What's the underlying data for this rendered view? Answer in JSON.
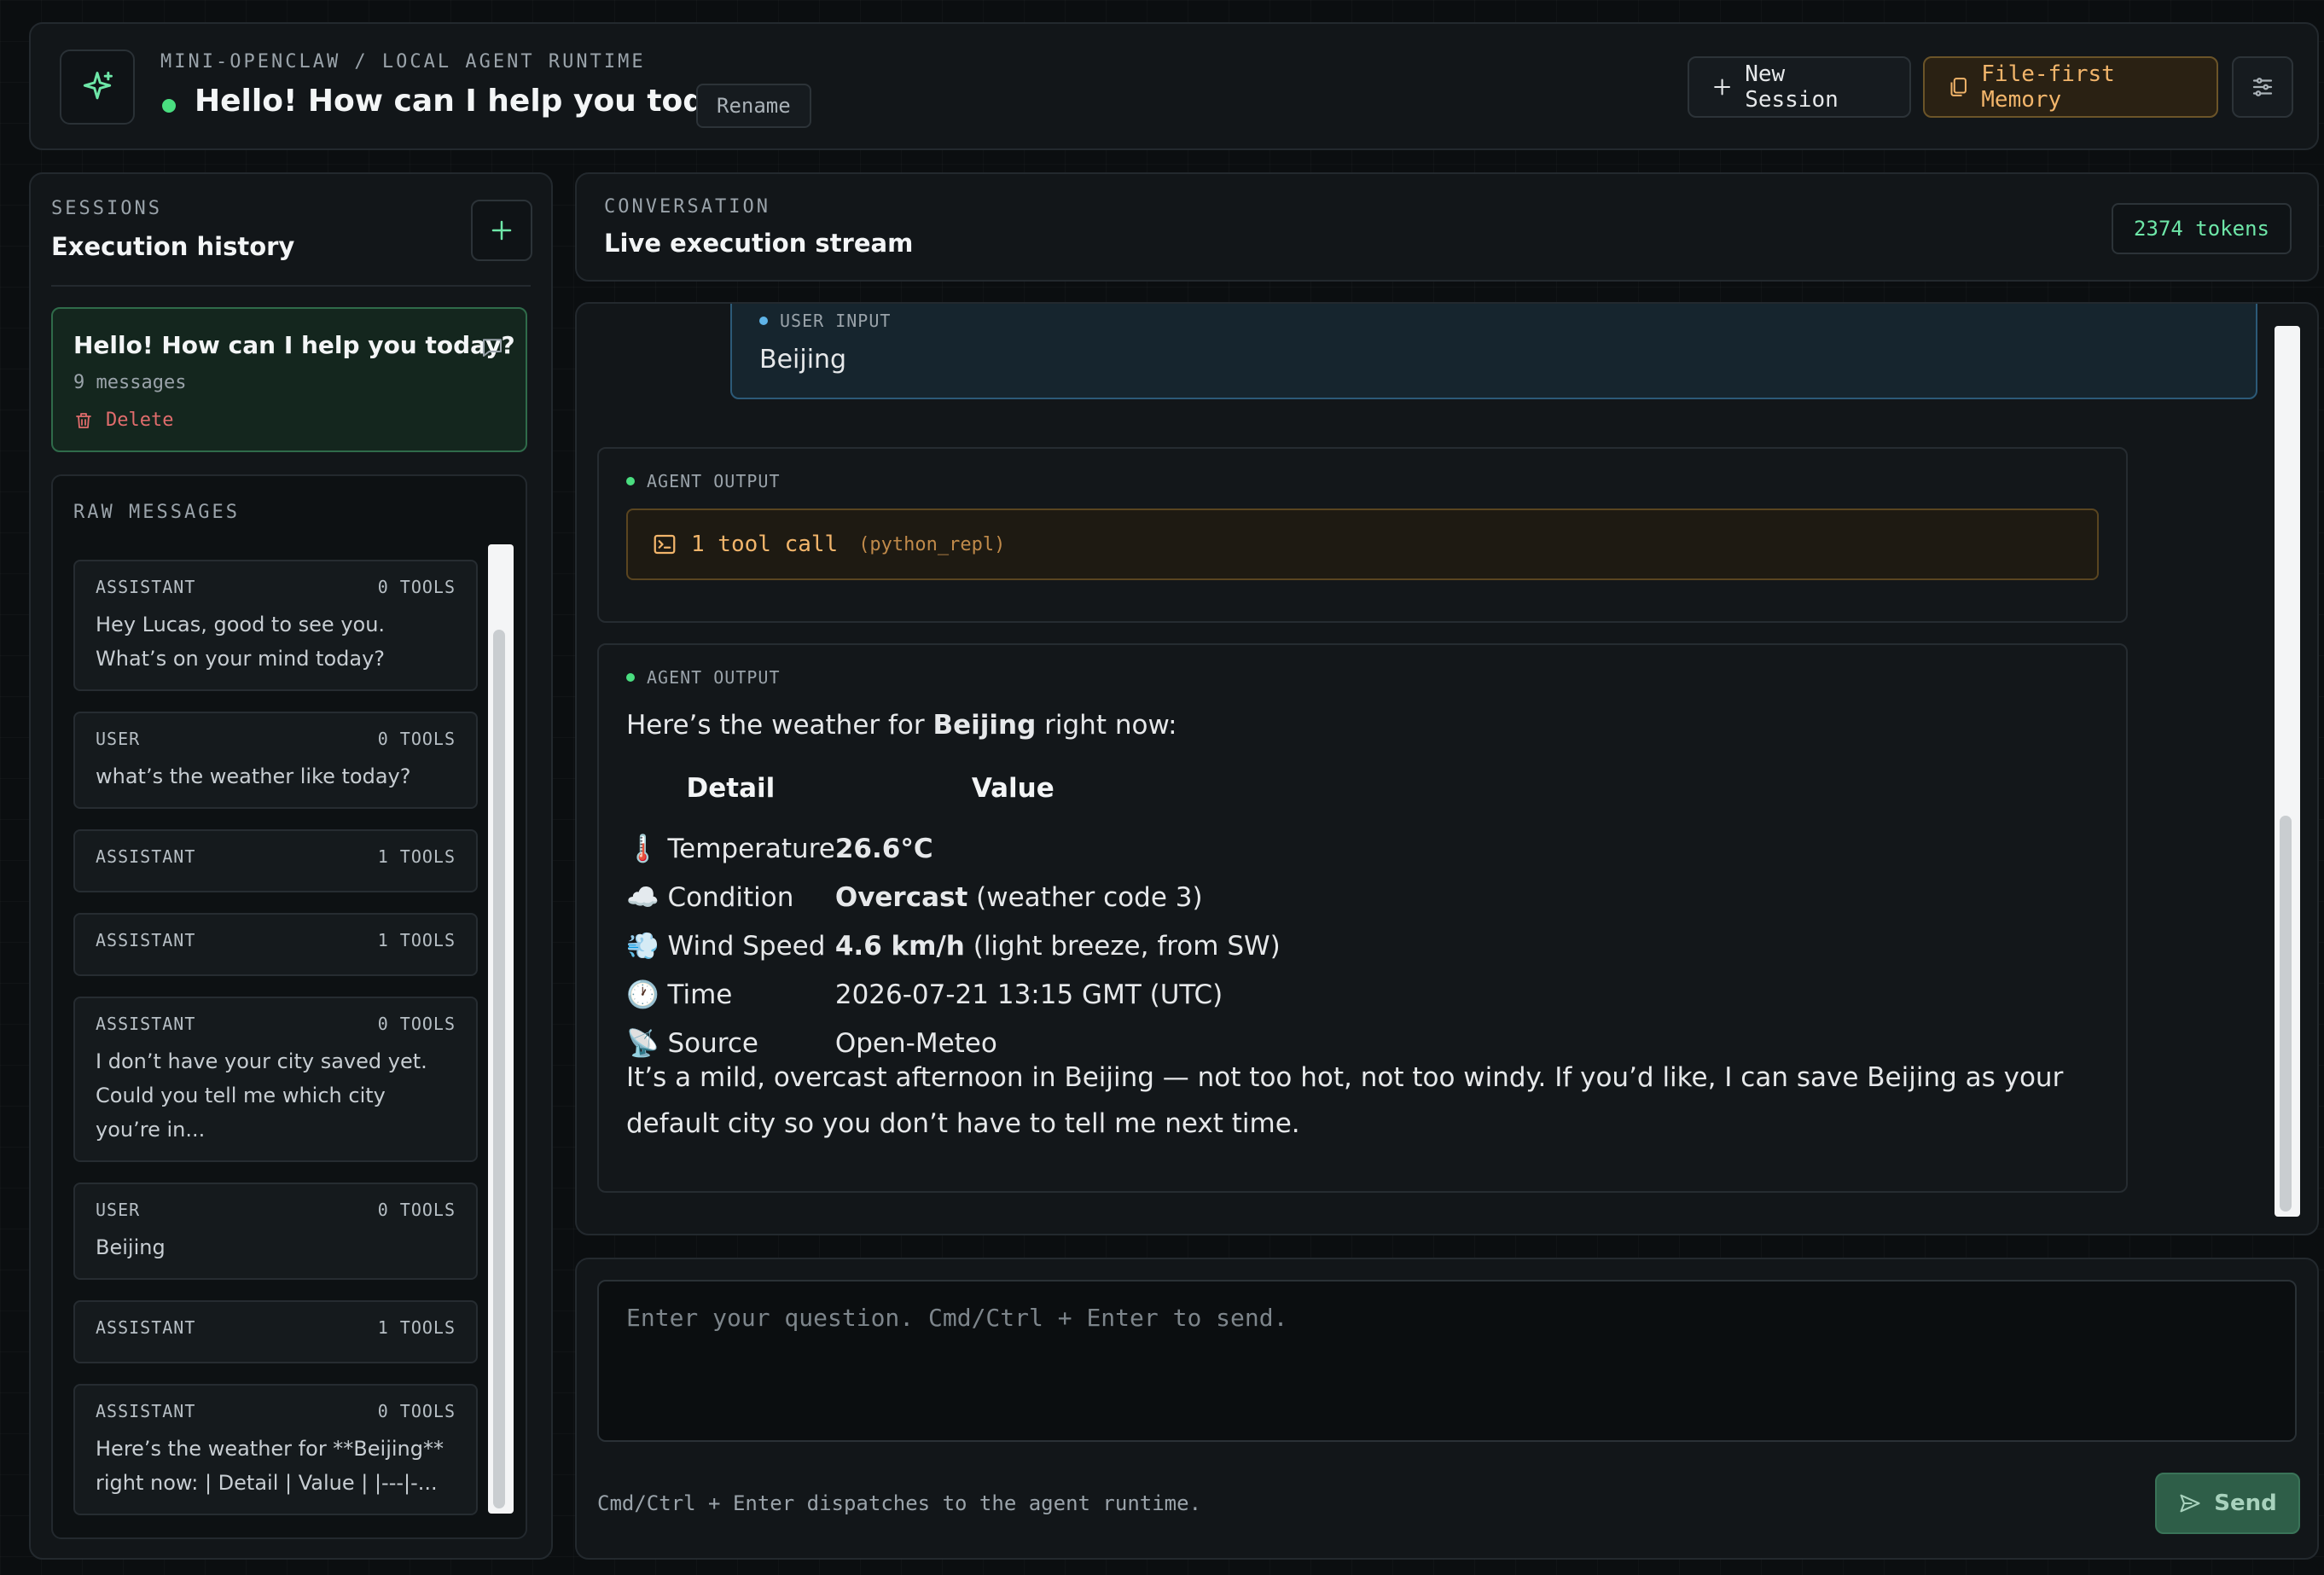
{
  "header": {
    "eyebrow": "MINI-OPENCLAW / LOCAL AGENT RUNTIME",
    "title": "Hello! How can I help you today?",
    "rename_label": "Rename",
    "new_session_label": "New Session",
    "memory_label": "File-first Memory",
    "logo_icon": "sparkle-icon",
    "settings_icon": "sliders-icon",
    "accent_color": "#4ade80"
  },
  "sidebar": {
    "eyebrow": "SESSIONS",
    "title": "Execution history",
    "session": {
      "title": "Hello! How can I help you today?",
      "meta": "9 messages",
      "delete_label": "Delete"
    },
    "raw_label": "RAW MESSAGES",
    "raw_messages": [
      {
        "role": "ASSISTANT",
        "tools": "0 TOOLS",
        "text": "Hey Lucas, good to see you. What’s on your mind today?"
      },
      {
        "role": "USER",
        "tools": "0 TOOLS",
        "text": "what’s the weather like today?"
      },
      {
        "role": "ASSISTANT",
        "tools": "1 TOOLS",
        "text": ""
      },
      {
        "role": "ASSISTANT",
        "tools": "1 TOOLS",
        "text": ""
      },
      {
        "role": "ASSISTANT",
        "tools": "0 TOOLS",
        "text": "I don’t have your city saved yet. Could you tell me which city you’re in..."
      },
      {
        "role": "USER",
        "tools": "0 TOOLS",
        "text": "Beijing"
      },
      {
        "role": "ASSISTANT",
        "tools": "1 TOOLS",
        "text": ""
      },
      {
        "role": "ASSISTANT",
        "tools": "0 TOOLS",
        "text": "Here’s the weather for **Beijing** right now: | Detail | Value | |---|-..."
      }
    ]
  },
  "conversation": {
    "eyebrow": "CONVERSATION",
    "title": "Live execution stream",
    "tokens": "2374 tokens"
  },
  "stream": {
    "user_tag": "USER INPUT",
    "user_text": "Beijing",
    "agent_tag": "AGENT OUTPUT",
    "tool_call_label": "1 tool call",
    "tool_call_name": "(python_repl)",
    "intro_pre": "Here’s the weather for ",
    "intro_bold": "Beijing",
    "intro_post": " right now:",
    "table": {
      "headers": [
        "Detail",
        "Value"
      ],
      "rows": [
        {
          "emoji": "🌡️",
          "detail": "Temperature",
          "bold": "26.6°C",
          "rest": ""
        },
        {
          "emoji": "☁️",
          "detail": "Condition",
          "bold": "Overcast",
          "rest": " (weather code 3)"
        },
        {
          "emoji": "💨",
          "detail": "Wind Speed",
          "bold": "4.6 km/h",
          "rest": " (light breeze, from SW)"
        },
        {
          "emoji": "🕐",
          "detail": "Time",
          "bold": "",
          "rest": "2026-07-21 13:15 GMT (UTC)"
        },
        {
          "emoji": "📡",
          "detail": "Source",
          "bold": "",
          "rest": "Open-Meteo"
        }
      ]
    },
    "closing": "It’s a mild, overcast afternoon in Beijing — not too hot, not too windy. If you’d like, I can save Beijing as your default city so you don’t have to tell me next time."
  },
  "composer": {
    "placeholder": "Enter your question. Cmd/Ctrl + Enter to send.",
    "value": "",
    "hint": "Cmd/Ctrl + Enter dispatches to the agent runtime.",
    "send_label": "Send"
  }
}
